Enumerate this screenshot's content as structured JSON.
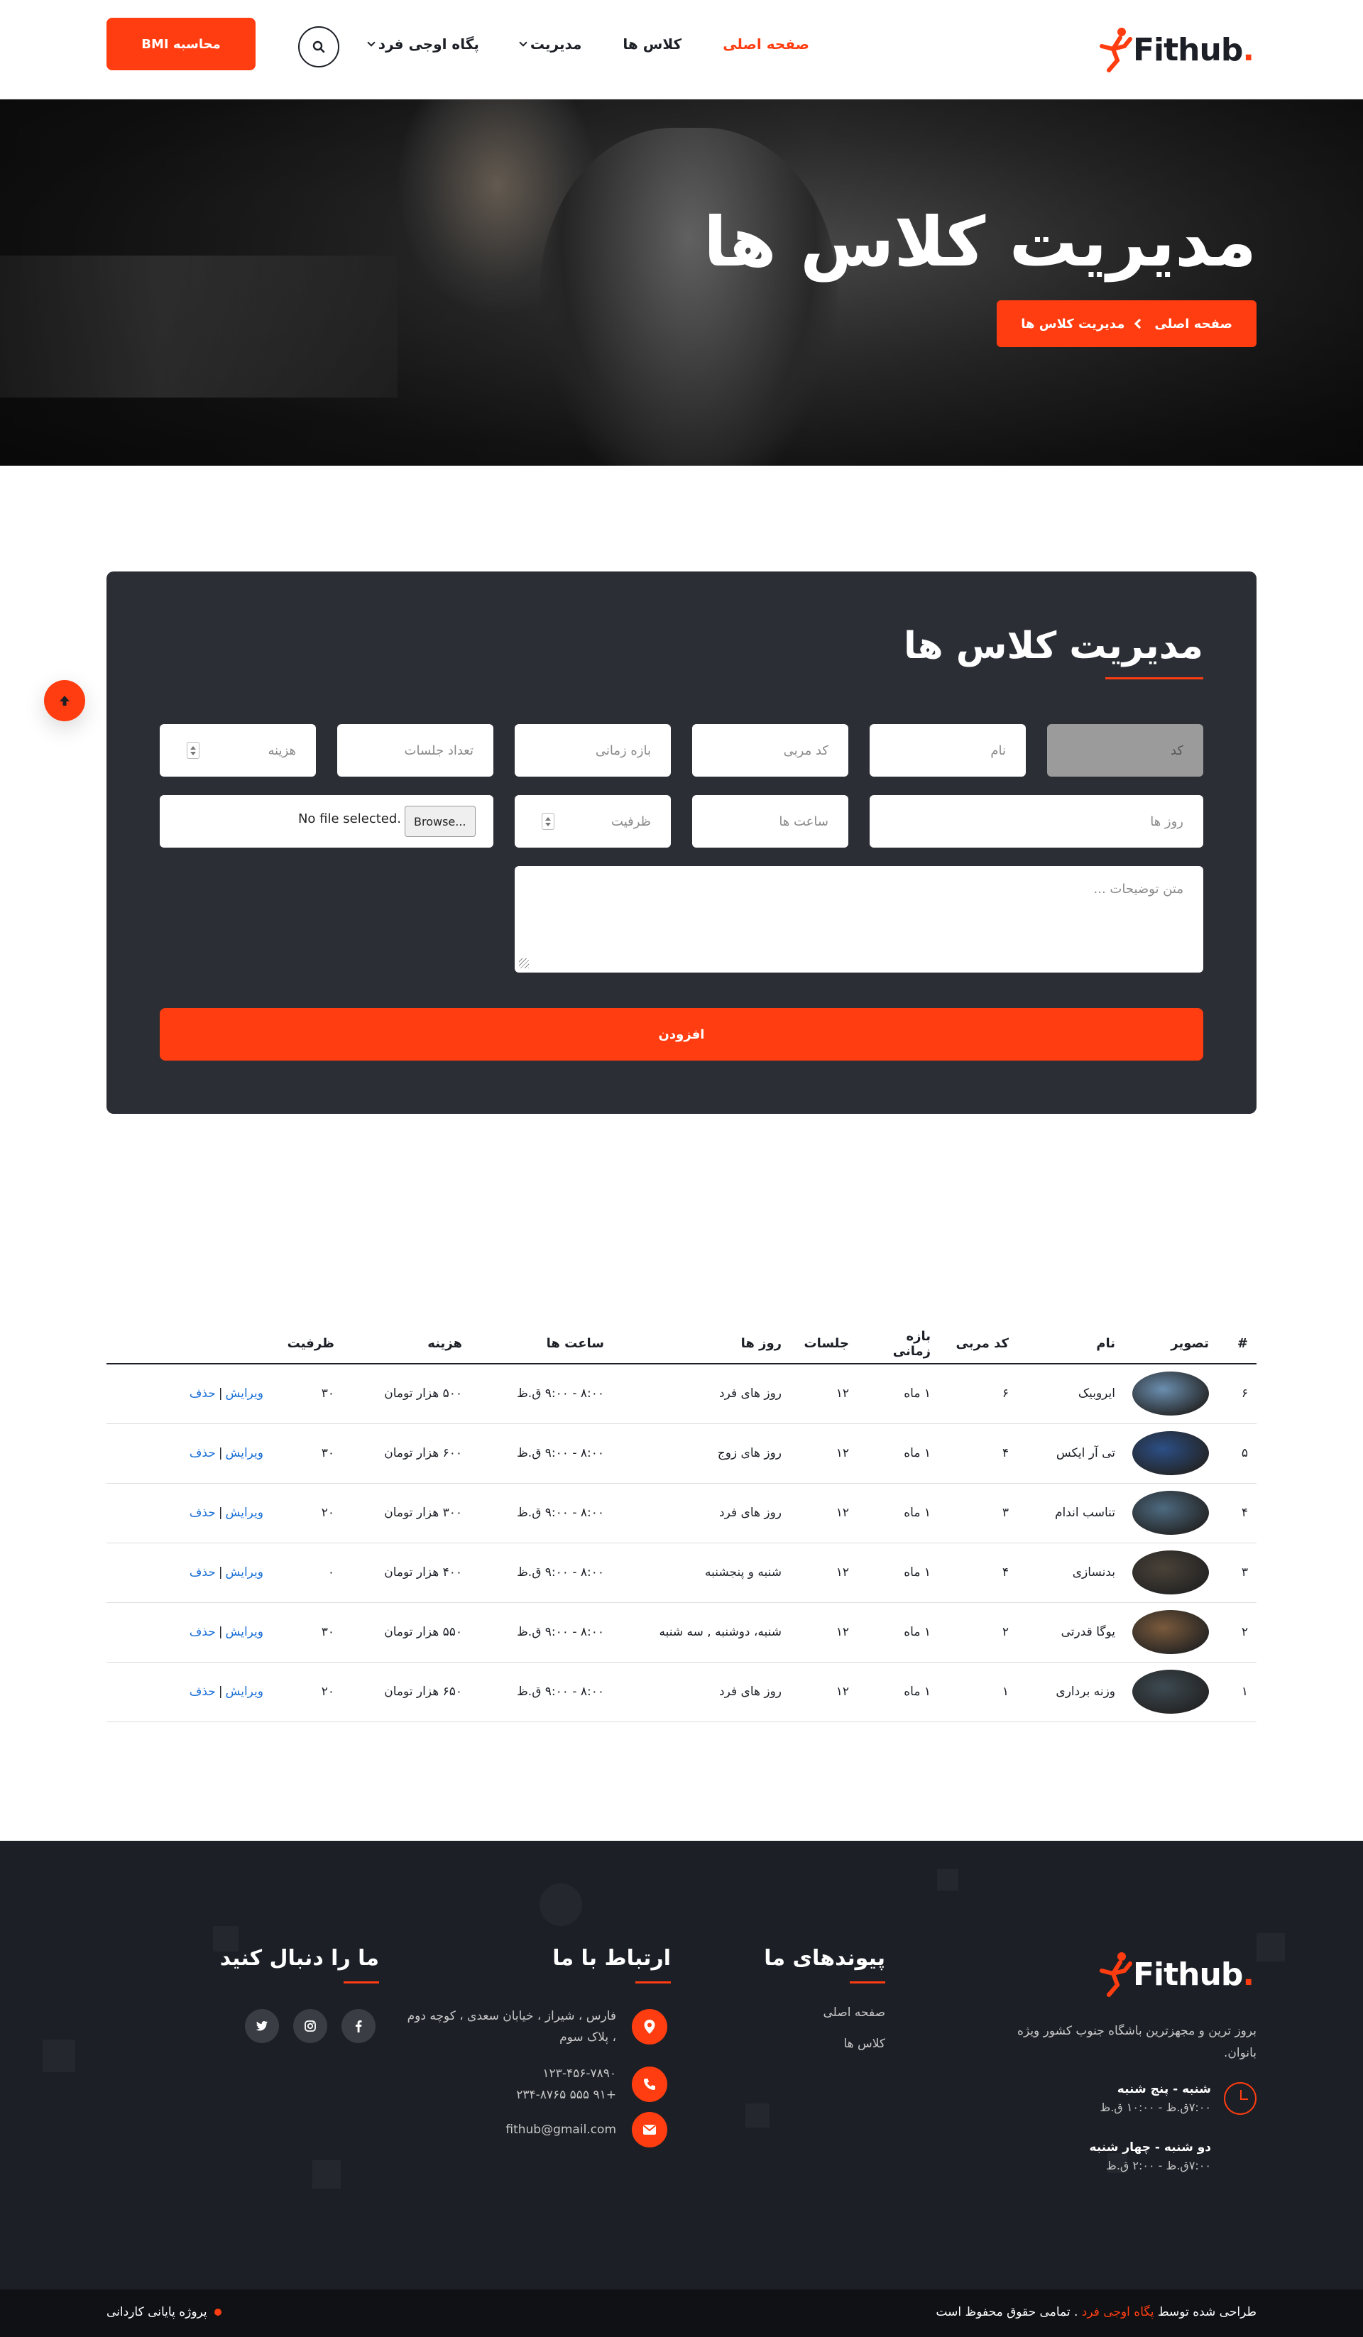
{
  "header": {
    "logo_text": "Fithub",
    "nav": [
      {
        "label": "صفحه اصلی",
        "active": true,
        "dropdown": false
      },
      {
        "label": "کلاس ها",
        "active": false,
        "dropdown": false
      },
      {
        "label": "مدیریت",
        "active": false,
        "dropdown": true
      },
      {
        "label": "پگاه اوجی فرد",
        "active": false,
        "dropdown": true
      }
    ],
    "bmi_button": "محاسبه BMI",
    "search_icon": "search-icon"
  },
  "hero": {
    "title": "مدیریت کلاس ها",
    "breadcrumb": {
      "home": "صفحه اصلی",
      "current": "مدیریت کلاس ها"
    }
  },
  "form": {
    "title": "مدیریت کلاس ها",
    "placeholders": {
      "code": "کد",
      "name": "نام",
      "coach_code": "کد مربی",
      "period": "بازه زمانی",
      "sessions": "تعداد جلسات",
      "cost": "هزینه",
      "days": "روز ها",
      "hours": "ساعت ها",
      "capacity": "ظرفیت",
      "description": "متن توضیحات ..."
    },
    "file_browse": "Browse...",
    "file_status": "No file selected.",
    "submit": "افزودن"
  },
  "table": {
    "headers": [
      "#",
      "تصویر",
      "نام",
      "کد مربی",
      "بازه زمانی",
      "جلسات",
      "روز ها",
      "ساعت ها",
      "هزینه",
      "ظرفیت",
      ""
    ],
    "rows": [
      {
        "num": "۶",
        "name": "ایروبیک",
        "coach": "۶",
        "period": "۱ ماه",
        "sessions": "۱۲",
        "days": "روز های فرد",
        "hours": "۸:۰۰ - ۹:۰۰ ق.ظ",
        "cost": "۵۰۰ هزار تومان",
        "capacity": "۳۰",
        "img": "#6b8fb0"
      },
      {
        "num": "۵",
        "name": "تی آر ایکس",
        "coach": "۴",
        "period": "۱ ماه",
        "sessions": "۱۲",
        "days": "روز های زوج",
        "hours": "۸:۰۰ - ۹:۰۰ ق.ظ",
        "cost": "۶۰۰ هزار تومان",
        "capacity": "۳۰",
        "img": "#2c4f86"
      },
      {
        "num": "۴",
        "name": "تناسب اندام",
        "coach": "۳",
        "period": "۱ ماه",
        "sessions": "۱۲",
        "days": "روز های فرد",
        "hours": "۸:۰۰ - ۹:۰۰ ق.ظ",
        "cost": "۳۰۰ هزار تومان",
        "capacity": "۲۰",
        "img": "#4d6a80"
      },
      {
        "num": "۳",
        "name": "بدنسازی",
        "coach": "۴",
        "period": "۱ ماه",
        "sessions": "۱۲",
        "days": "شنبه و پنجشنبه",
        "hours": "۸:۰۰ - ۹:۰۰ ق.ظ",
        "cost": "۴۰۰ هزار تومان",
        "capacity": "۰",
        "img": "#4a4238"
      },
      {
        "num": "۲",
        "name": "یوگا قدرتی",
        "coach": "۲",
        "period": "۱ ماه",
        "sessions": "۱۲",
        "days": "شنبه، دوشنبه , سه شنبه",
        "hours": "۸:۰۰ - ۹:۰۰ ق.ظ",
        "cost": "۵۵۰ هزار تومان",
        "capacity": "۳۰",
        "img": "#7a5a3c"
      },
      {
        "num": "۱",
        "name": "وزنه برداری",
        "coach": "۱",
        "period": "۱ ماه",
        "sessions": "۱۲",
        "days": "روز های فرد",
        "hours": "۸:۰۰ - ۹:۰۰ ق.ظ",
        "cost": "۶۵۰ هزار تومان",
        "capacity": "۲۰",
        "img": "#3d4a52"
      }
    ],
    "edit_label": "ویرایش",
    "delete_label": "حذف",
    "separator": "|"
  },
  "footer": {
    "logo_text": "Fithub",
    "description": "بروز ترین و مجهزترین باشگاه جنوب کشور ویژه بانوان.",
    "hours": [
      {
        "day": "شنبه - پنج شنبه",
        "time": "۷:۰۰ق.ظ - ۱۰:۰۰ ق.ظ"
      },
      {
        "day": "دو شنبه - چهار شنبه",
        "time": "۷:۰۰ق.ظ - ۲:۰۰ ق.ظ"
      }
    ],
    "links_title": "پیوندهای ما",
    "links": [
      "صفحه اصلی",
      "کلاس ها"
    ],
    "contact_title": "ارتباط با ما",
    "address": "فارس ، شیراز ، خیابان سعدی ، کوچه دوم ، پلاک سوم",
    "phone1": "۱۲۳-۴۵۶-۷۸۹۰",
    "phone2": "+۹۱ ۵۵۵ ۲۳۴-۸۷۶۵",
    "email": "fithub@gmail.com",
    "follow_title": "ما را دنبال کنید",
    "social": [
      "facebook-icon",
      "instagram-icon",
      "twitter-icon"
    ]
  },
  "bottom_bar": {
    "copyright_prefix": "طراحی شده توسط",
    "copyright_name": "پگاه اوجی فرد",
    "copyright_suffix": ". تمامی حقوق محفوظ است",
    "project": "پروژه پایانی کاردانی"
  },
  "colors": {
    "accent": "#ff3d10",
    "dark": "#1c1f26",
    "panel": "#2b2e35",
    "link": "#1a6fd6"
  }
}
